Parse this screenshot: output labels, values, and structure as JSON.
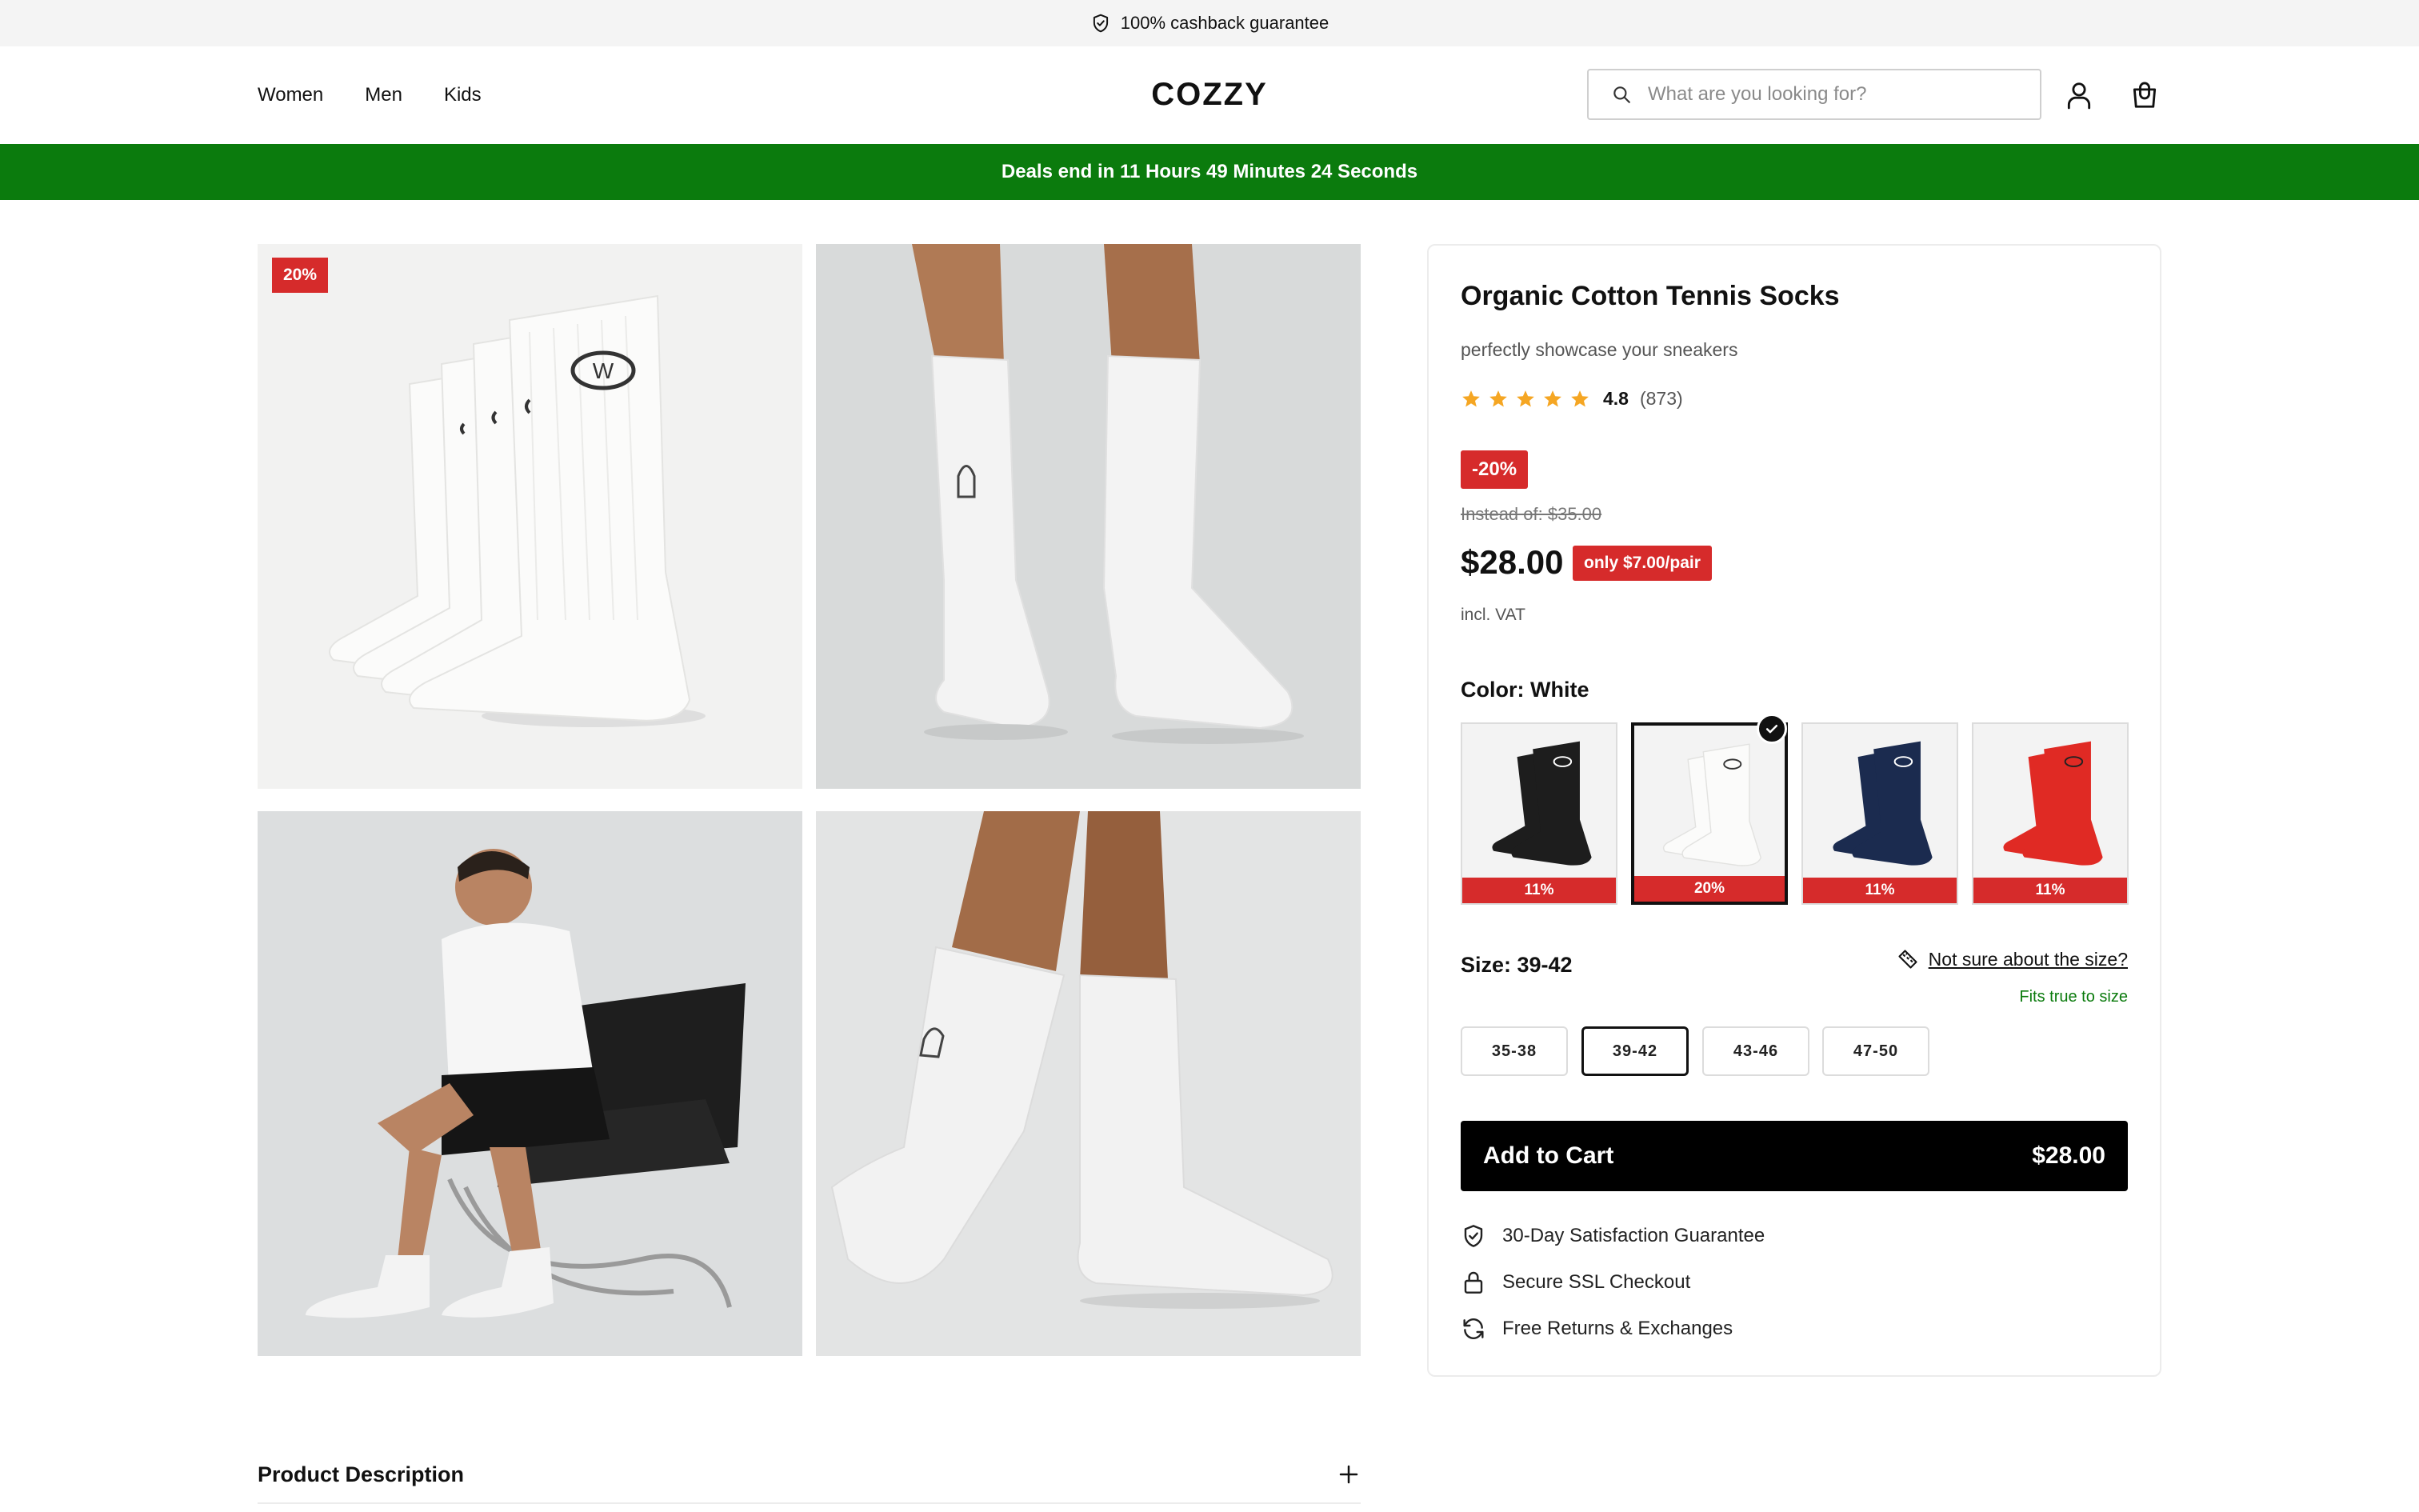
{
  "announcement": {
    "text": "100% cashback guarantee",
    "icon": "shield-check-icon"
  },
  "header": {
    "nav": [
      "Women",
      "Men",
      "Kids"
    ],
    "logo": "COZZY",
    "search_placeholder": "What are you looking for?",
    "icons": [
      "search-icon",
      "account-icon",
      "cart-bag-icon"
    ]
  },
  "deals": {
    "text": "Deals end in 11 Hours 49 Minutes 24 Seconds",
    "color": "#0b7b0d"
  },
  "gallery": {
    "badge": "20%",
    "images": [
      "white-socks-packshot",
      "legs-wearing-white-socks",
      "man-on-leather-chair",
      "legs-walking-white-socks"
    ]
  },
  "product": {
    "title": "Organic Cotton Tennis Socks",
    "subtitle": "perfectly showcase your sneakers",
    "rating": {
      "score": "4.8",
      "count": "(873)",
      "stars": 5,
      "star_color": "#f5a623"
    },
    "discount_badge": "-20%",
    "instead_price": "Instead of: $35.00",
    "price": "$28.00",
    "per_pair": "only $7.00/pair",
    "vat": "incl. VAT",
    "color_label": "Color: White",
    "colors": [
      {
        "name": "Black",
        "pct": "11%",
        "sock": "#1d1d1d"
      },
      {
        "name": "White",
        "pct": "20%",
        "sock": "#f7f7f5",
        "selected": true
      },
      {
        "name": "Navy",
        "pct": "11%",
        "sock": "#1b2b4f"
      },
      {
        "name": "Red",
        "pct": "11%",
        "sock": "#e02a24"
      }
    ],
    "size_label": "Size: 39-42",
    "size_help": "Not sure about the size?",
    "fits": "Fits true to size",
    "sizes": [
      "35-38",
      "39-42",
      "43-46",
      "47-50"
    ],
    "selected_size": "39-42",
    "add_to_cart": "Add to Cart",
    "cart_price": "$28.00",
    "perks": [
      {
        "icon": "shield-check-icon",
        "text": "30-Day Satisfaction Guarantee"
      },
      {
        "icon": "lock-icon",
        "text": "Secure SSL Checkout"
      },
      {
        "icon": "refresh-icon",
        "text": "Free Returns & Exchanges"
      }
    ]
  },
  "description": {
    "label": "Product Description"
  },
  "colors": {
    "sale_red": "#d62b2b",
    "success_green": "#0b7b0d",
    "black": "#000000"
  }
}
